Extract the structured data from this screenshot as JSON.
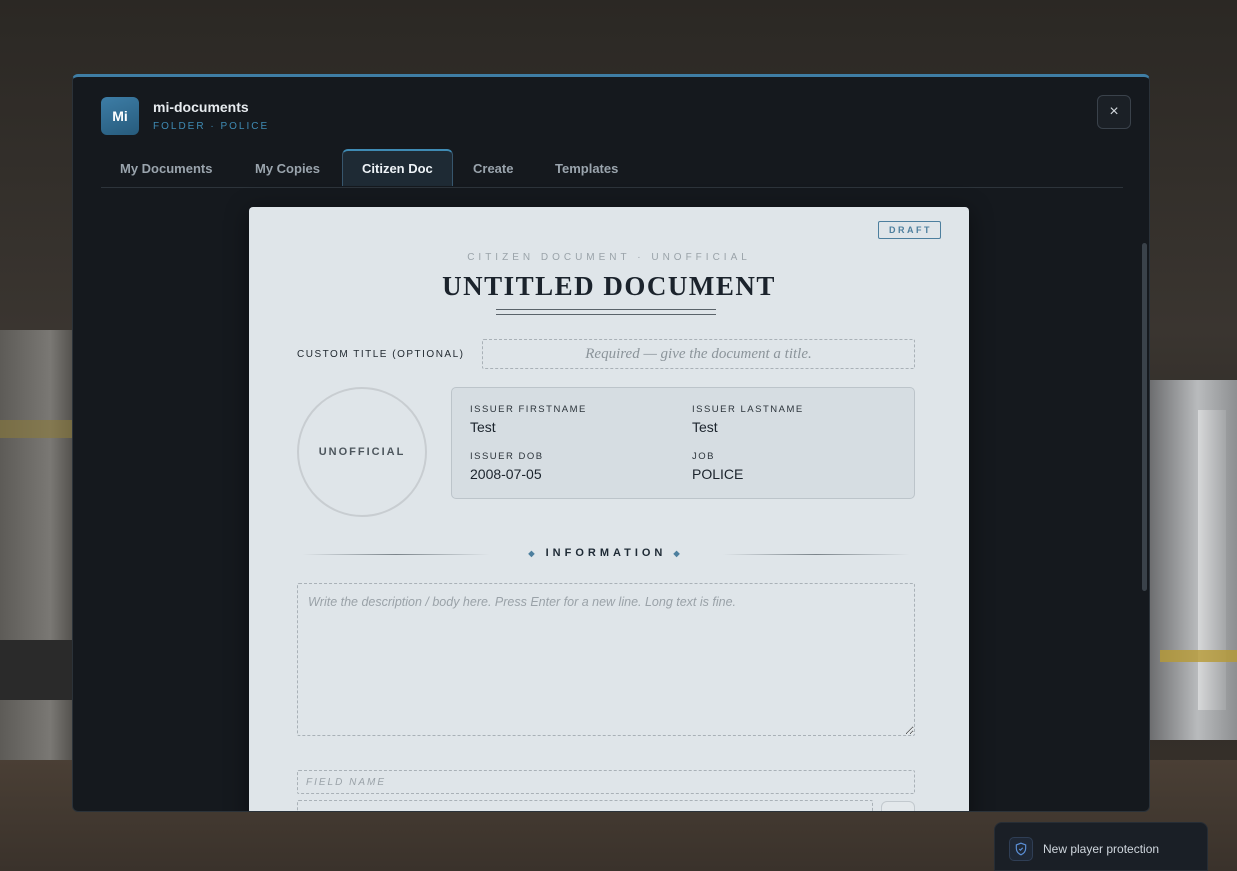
{
  "app": {
    "badge": "Mi",
    "title": "mi-documents",
    "subtitle": "FOLDER · POLICE",
    "close_label": "×"
  },
  "tabs": [
    {
      "label": "My Documents",
      "active": false
    },
    {
      "label": "My Copies",
      "active": false
    },
    {
      "label": "Citizen Doc",
      "active": true
    },
    {
      "label": "Create",
      "active": false
    },
    {
      "label": "Templates",
      "active": false
    }
  ],
  "document": {
    "status_badge": "DRAFT",
    "kicker": "CITIZEN DOCUMENT · UNOFFICIAL",
    "title": "UNTITLED DOCUMENT",
    "custom_title_label": "CUSTOM TITLE (OPTIONAL)",
    "custom_title_placeholder": "Required — give the document a title.",
    "seal_text": "UNOFFICIAL",
    "issuer": {
      "firstname_label": "ISSUER FIRSTNAME",
      "firstname": "Test",
      "lastname_label": "ISSUER LASTNAME",
      "lastname": "Test",
      "dob_label": "ISSUER DOB",
      "dob": "2008-07-05",
      "job_label": "JOB",
      "job": "POLICE"
    },
    "section_label": "INFORMATION",
    "description_placeholder": "Write the description / body here. Press Enter for a new line. Long text is fine.",
    "field_name_placeholder": "FIELD NAME"
  },
  "toast": {
    "text": "New player protection",
    "icon": "shield-icon"
  },
  "colors": {
    "accent": "#3f8bb4",
    "window_bg": "#15191e",
    "paper_bg": "#dfe5e9"
  }
}
